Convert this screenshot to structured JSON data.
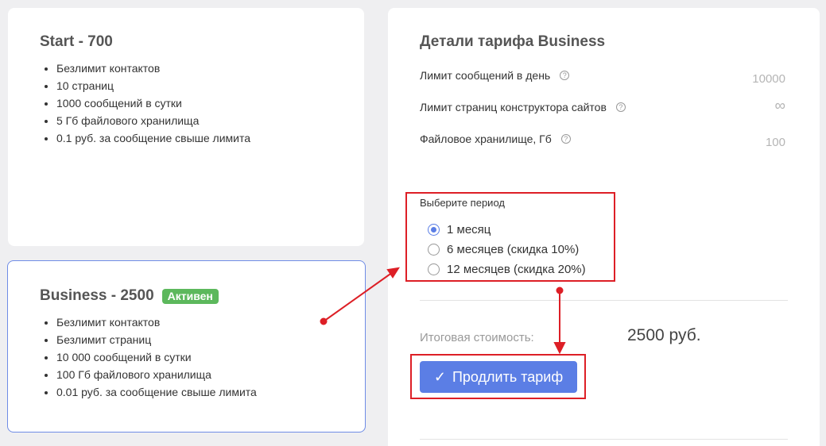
{
  "plans": [
    {
      "title": "Start - 700",
      "features": [
        "Безлимит контактов",
        "10 страниц",
        "1000 сообщений в сутки",
        "5 Гб файлового хранилища",
        "0.1 руб. за сообщение свыше лимита"
      ]
    },
    {
      "title": "Business - 2500",
      "badge": "Активен",
      "features": [
        "Безлимит контактов",
        "Безлимит страниц",
        "10 000 сообщений в сутки",
        "100 Гб файлового хранилища",
        "0.01 руб. за сообщение свыше лимита"
      ]
    }
  ],
  "details": {
    "title": "Детали тарифа Business",
    "params": [
      {
        "label": "Лимит сообщений в день",
        "value": "10000",
        "help_icon": "question-circle"
      },
      {
        "label": "Лимит страниц конструктора сайтов",
        "value": "∞",
        "help_icon": "question-circle"
      },
      {
        "label": "Файловое хранилище, Гб",
        "value": "100",
        "help_icon": "question-circle"
      }
    ],
    "period_label": "Выберите период",
    "periods": [
      {
        "label": "1 месяц",
        "selected": true
      },
      {
        "label": "6 месяцев (скидка 10%)",
        "selected": false
      },
      {
        "label": "12 месяцев (скидка 20%)",
        "selected": false
      }
    ],
    "total_label": "Итоговая стоимость:",
    "total_value": "2500 руб.",
    "renew_button": "Продлить тариф",
    "help_glyph": "?",
    "check_glyph": "✓"
  },
  "colors": {
    "accent": "#5b7ee5",
    "active_badge": "#5cb85c",
    "annotation": "#dd1f26"
  }
}
